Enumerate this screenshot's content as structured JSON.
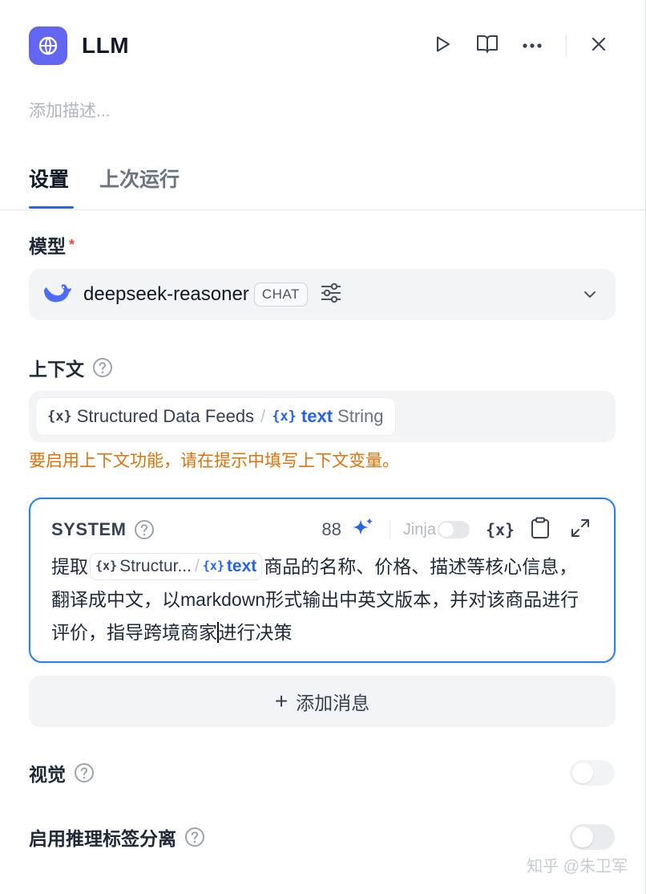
{
  "node": {
    "title": "LLM",
    "description_placeholder": "添加描述..."
  },
  "header_actions": [
    "play-icon",
    "book-icon",
    "more-icon",
    "close-icon"
  ],
  "tabs": [
    {
      "label": "设置",
      "active": true
    },
    {
      "label": "上次运行",
      "active": false
    }
  ],
  "model": {
    "label": "模型",
    "required_mark": "*",
    "name": "deepseek-reasoner",
    "mode_badge": "CHAT"
  },
  "context": {
    "label": "上下文",
    "variable": {
      "node_name": "Structured Data Feeds",
      "separator": "/",
      "var_name": "text",
      "var_type": "String"
    },
    "warning": "要启用上下文功能，请在提示中填写上下文变量。"
  },
  "system_prompt": {
    "role": "SYSTEM",
    "token_count": "88",
    "jinja_label": "Jinja",
    "jinja_enabled": false,
    "text_before": "提取",
    "chip": {
      "node_name": "Structur...",
      "separator": "/",
      "var_name": "text"
    },
    "text_after": "商品的名称、价格、描述等核心信息，翻译成中文，以markdown形式输出中英文版本，并对该商品进行评价，指导跨境商家",
    "text_after_cursor": "进行决策"
  },
  "add_message_label": "添加消息",
  "vision": {
    "label": "视觉",
    "enabled": false
  },
  "reasoning_split": {
    "label": "启用推理标签分离",
    "enabled": false
  },
  "watermark": "知乎 @朱卫军",
  "colors": {
    "accent": "#2563eb",
    "app_icon": "#6366f1",
    "warning": "#d9730d",
    "required": "#ef4444"
  }
}
